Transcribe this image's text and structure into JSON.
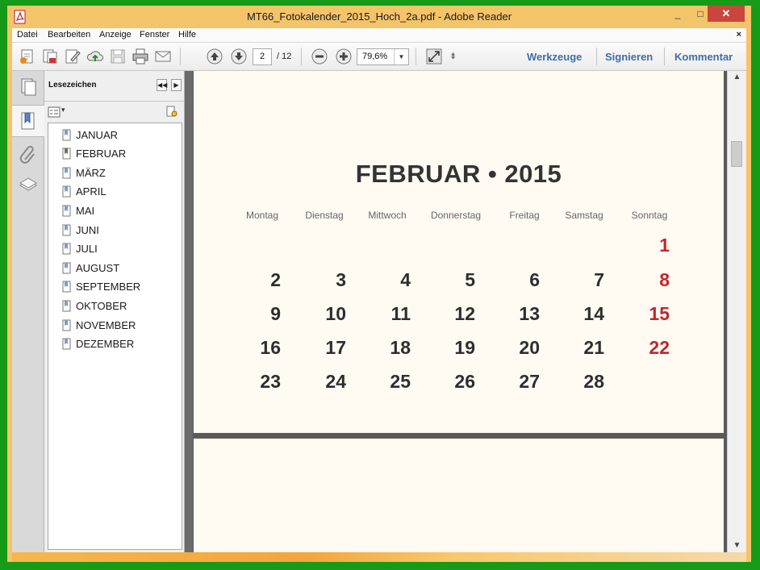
{
  "window": {
    "title": "MT66_Fotokalender_2015_Hoch_2a.pdf - Adobe Reader",
    "minimize": "_",
    "maximize": "□",
    "close": "✕"
  },
  "menu": {
    "items": [
      "Datei",
      "Bearbeiten",
      "Anzeige",
      "Fenster",
      "Hilfe"
    ],
    "close": "×"
  },
  "toolbar": {
    "current_page": "2",
    "total_pages": "/ 12",
    "zoom": "79,6%",
    "zoom_drop": "▼",
    "more": "⇟",
    "links": [
      "Werkzeuge",
      "Signieren",
      "Kommentar"
    ]
  },
  "bookmarks": {
    "title": "Lesezeichen",
    "collapse": "◀◀",
    "expand": "▶",
    "options": "▾",
    "items": [
      "JANUAR",
      "FEBRUAR",
      "MÄRZ",
      "APRIL",
      "MAI",
      "JUNI",
      "JULI",
      "AUGUST",
      "SEPTEMBER",
      "OKTOBER",
      "NOVEMBER",
      "DEZEMBER"
    ],
    "selected": "FEBRUAR"
  },
  "calendar": {
    "title": "FEBRUAR • 2015",
    "weekdays": [
      "Montag",
      "Dienstag",
      "Mittwoch",
      "Donnerstag",
      "Freitag",
      "Samstag",
      "Sonntag"
    ],
    "weeks": [
      [
        "",
        "",
        "",
        "",
        "",
        "",
        "1"
      ],
      [
        "2",
        "3",
        "4",
        "5",
        "6",
        "7",
        "8"
      ],
      [
        "9",
        "10",
        "11",
        "12",
        "13",
        "14",
        "15"
      ],
      [
        "16",
        "17",
        "18",
        "19",
        "20",
        "21",
        "22"
      ],
      [
        "23",
        "24",
        "25",
        "26",
        "27",
        "28",
        ""
      ]
    ],
    "sunday_color": "#c1272d"
  },
  "scrollbar": {
    "up": "▲",
    "down": "▼"
  },
  "colors": {
    "frame": "#179a17",
    "titlebar": "#f4c46a",
    "link": "#3e6ea8",
    "close_button": "#c9463c"
  }
}
